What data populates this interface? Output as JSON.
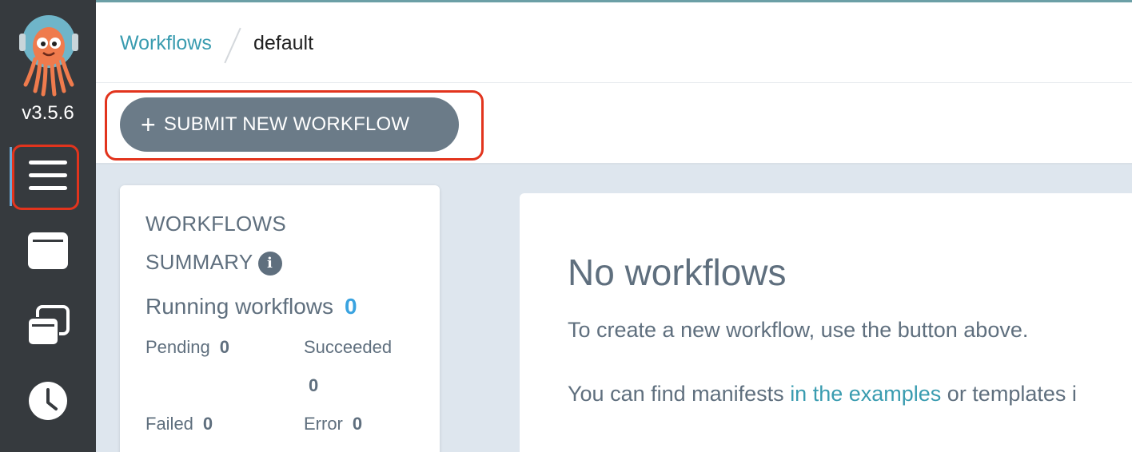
{
  "sidebar": {
    "version": "v3.5.6",
    "nav": [
      {
        "icon": "menu-icon"
      },
      {
        "icon": "window-icon"
      },
      {
        "icon": "stacked-windows-icon"
      },
      {
        "icon": "clock-icon"
      }
    ]
  },
  "breadcrumb": {
    "link": "Workflows",
    "current": "default"
  },
  "toolbar": {
    "submit_label": "SUBMIT NEW WORKFLOW",
    "plus": "+"
  },
  "summary": {
    "title": "WORKFLOWS SUMMARY",
    "info_icon": "i",
    "running_label": "Running workflows",
    "running_count": "0",
    "pending_label": "Pending",
    "pending_count": "0",
    "succeeded_label": "Succeeded",
    "succeeded_count": "0",
    "failed_label": "Failed",
    "failed_count": "0",
    "error_label": "Error",
    "error_count": "0"
  },
  "main": {
    "title": "No workflows",
    "p1": "To create a new workflow, use the button above.",
    "p2_prefix": "You can find manifests ",
    "p2_link": "in the examples",
    "p2_suffix": " or templates i"
  },
  "colors": {
    "sidebar_bg": "#363a3e",
    "accent_link": "#3a9cb0",
    "submit_button": "#6b7b88",
    "highlight_box": "#e2341d",
    "count_blue": "#3aa3e0",
    "page_bg": "#dee6ee"
  }
}
